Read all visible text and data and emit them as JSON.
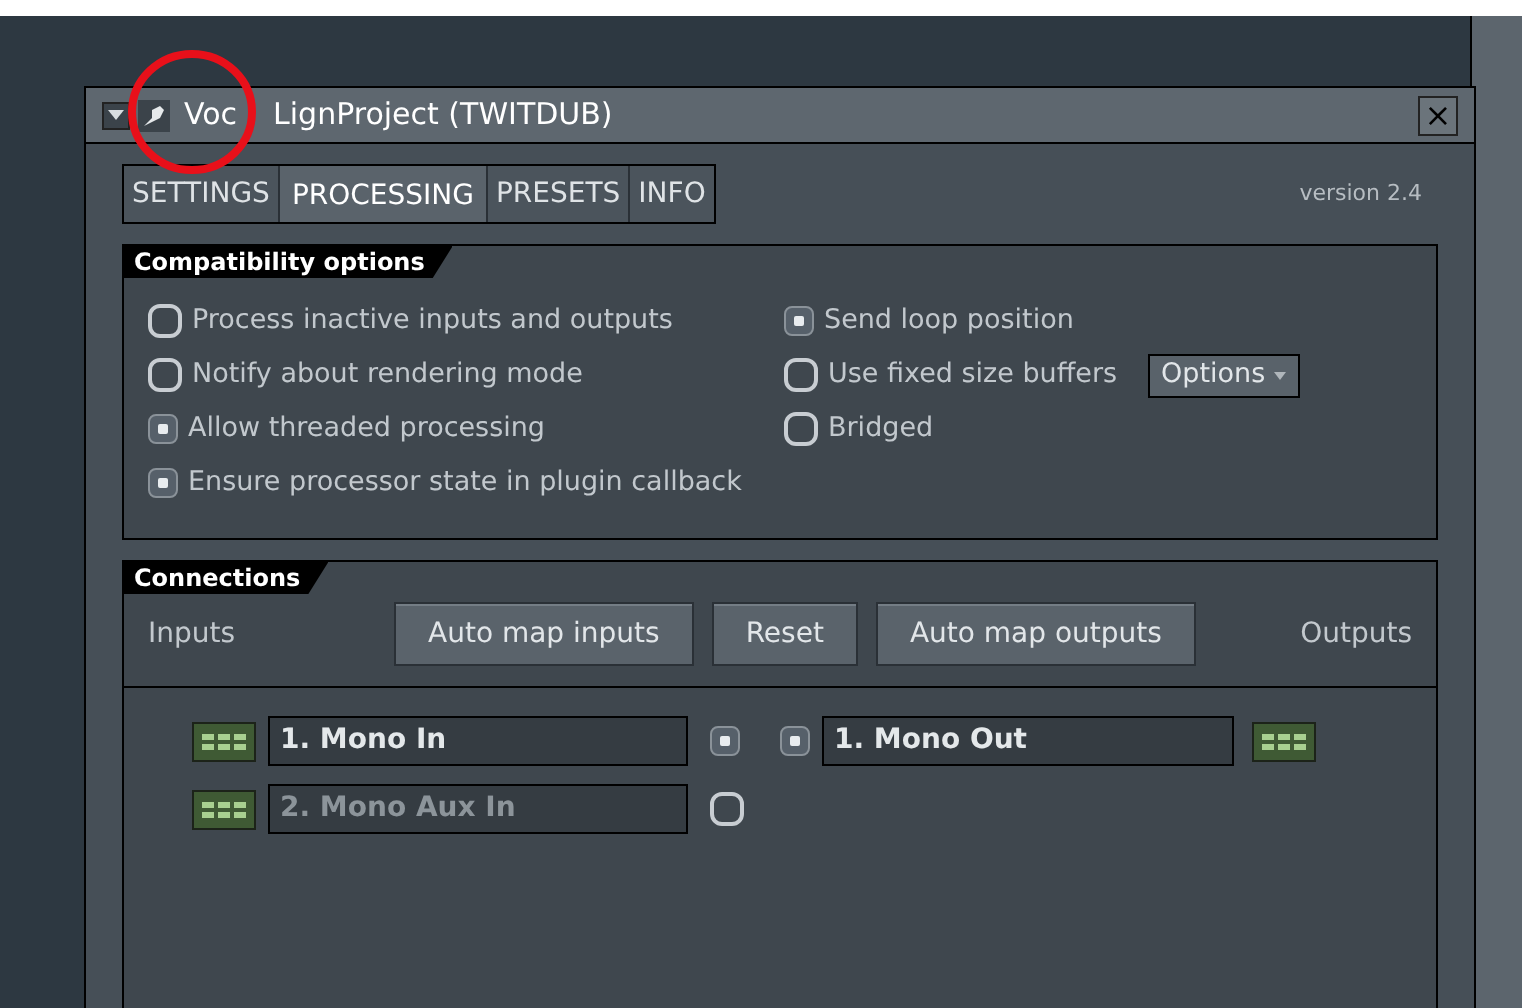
{
  "window": {
    "title_parts": [
      "Voc",
      "LignProject (TWITDUB)"
    ],
    "close": "×"
  },
  "tabs": [
    {
      "label": "SETTINGS",
      "selected": false
    },
    {
      "label": "PROCESSING",
      "selected": true
    },
    {
      "label": "PRESETS",
      "selected": false
    },
    {
      "label": "INFO",
      "selected": false
    }
  ],
  "version": "version 2.4",
  "compatibility": {
    "title": "Compatibility options",
    "left": [
      {
        "label": "Process inactive inputs and outputs",
        "checked": false
      },
      {
        "label": "Notify about rendering mode",
        "checked": false
      },
      {
        "label": "Allow threaded processing",
        "checked": true
      },
      {
        "label": "Ensure processor state in plugin callback",
        "checked": true
      }
    ],
    "right": [
      {
        "label": "Send loop position",
        "checked": true
      },
      {
        "label": "Use fixed size buffers",
        "checked": false
      },
      {
        "label": "Bridged",
        "checked": false
      }
    ],
    "options_button": "Options"
  },
  "connections": {
    "title": "Connections",
    "inputs_label": "Inputs",
    "outputs_label": "Outputs",
    "buttons": [
      "Auto map inputs",
      "Reset",
      "Auto map outputs"
    ],
    "inputs": [
      {
        "name": "1. Mono In",
        "checked": true,
        "disabled": false
      },
      {
        "name": "2. Mono Aux In",
        "checked": false,
        "disabled": true
      }
    ],
    "outputs": [
      {
        "name": "1. Mono Out",
        "checked": true,
        "disabled": false
      }
    ]
  }
}
